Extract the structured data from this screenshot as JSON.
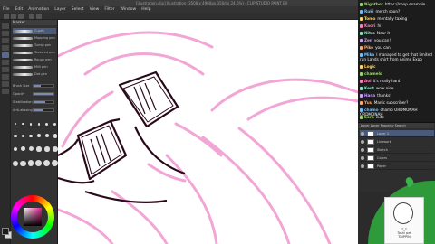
{
  "app": {
    "title": "[illustration.clip] Illustration (3508 x 4960px 350dpi 24.6%) - CLIP STUDIO PAINT EX",
    "menu": [
      "File",
      "Edit",
      "Animation",
      "Layer",
      "Select",
      "View",
      "Filter",
      "Window",
      "Help"
    ]
  },
  "brush_panel": {
    "tab_label": "Marker",
    "brushes": [
      {
        "label": "G-pen"
      },
      {
        "label": "Mapping pen"
      },
      {
        "label": "Turnip pen"
      },
      {
        "label": "Textured pen"
      },
      {
        "label": "Rough pen"
      },
      {
        "label": "Milli pen"
      },
      {
        "label": "Dot pen"
      }
    ],
    "properties": [
      {
        "label": "Brush Size",
        "value": 0.35
      },
      {
        "label": "Opacity",
        "value": 1.0
      },
      {
        "label": "Stabilization",
        "value": 0.6
      },
      {
        "label": "Anti-aliasing",
        "value": 0.5
      }
    ],
    "brush_sizes": [
      1,
      1.5,
      2,
      2.5,
      3,
      3.5,
      4,
      5,
      6,
      7,
      8,
      10,
      12,
      15,
      17,
      20,
      25,
      30,
      40,
      50,
      60,
      70,
      80,
      100
    ]
  },
  "colors": {
    "main": "#1a1a1a",
    "sub": "#d9d9d9",
    "sketch_line": "#f2a6d6",
    "ink_line": "#2a0a1a",
    "accent": "#4b5a78"
  },
  "chat": {
    "messages": [
      {
        "user": "Nightbot",
        "color": "#9ad56a",
        "text": "https://shop.example"
      },
      {
        "user": "Ruki",
        "color": "#6ac0ff",
        "text": "merch soon?"
      },
      {
        "user": "Tomo",
        "color": "#ffd25a",
        "text": "mentally taxing"
      },
      {
        "user": "Kaori",
        "color": "#ff7ab0",
        "text": "hi"
      },
      {
        "user": "Nitro",
        "color": "#8ae0c0",
        "text": "Near it"
      },
      {
        "user": "Zen",
        "color": "#c7a0ff",
        "text": "you can!"
      },
      {
        "user": "Piko",
        "color": "#ffa86a",
        "text": "you can"
      },
      {
        "user": "Mika",
        "color": "#6ac0ff",
        "text": "I managed to get that limited run Lands shirt from Anime Expo"
      },
      {
        "user": "Logic",
        "color": "#ffd25a",
        "text": ""
      },
      {
        "user": "chamelo",
        "color": "#9ad56a",
        "text": ""
      },
      {
        "user": "Aoi",
        "color": "#ff7ab0",
        "text": "it's really hard"
      },
      {
        "user": "Kent",
        "color": "#8ae0c0",
        "text": "wow nice"
      },
      {
        "user": "Hana",
        "color": "#c7a0ff",
        "text": "thanks!"
      },
      {
        "user": "Yuu",
        "color": "#ffa86a",
        "text": "Manic subscriber?"
      },
      {
        "user": "chamo",
        "color": "#6ac0ff",
        "text": "chamo ORDMONAH ORDMONAH"
      },
      {
        "user": "Sora",
        "color": "#9ad56a",
        "text": "cute"
      }
    ]
  },
  "layers": {
    "tabs": "Layer  Layer Property  Search",
    "items": [
      {
        "name": "Layer 1",
        "selected": true
      },
      {
        "name": "Linework",
        "selected": false
      },
      {
        "name": "Sketch",
        "selected": false
      },
      {
        "name": "Colors",
        "selected": false
      },
      {
        "name": "Paper",
        "selected": false
      }
    ]
  },
  "webcam": {
    "caption_line1": "T_T",
    "caption_line2": "Toshi pet",
    "caption_line3": "TRIPPIN"
  }
}
